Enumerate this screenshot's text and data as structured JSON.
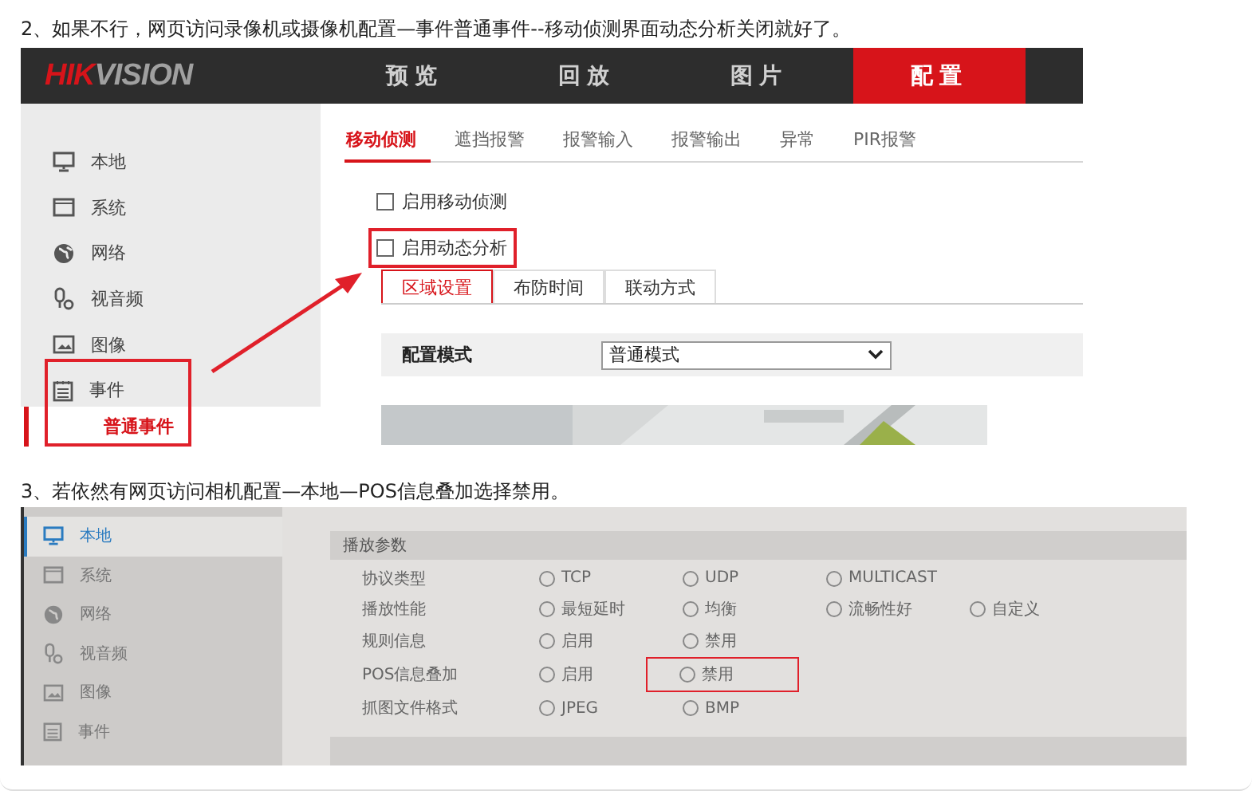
{
  "step_2": {
    "text": "2、如果不行，网页访问录像机或摄像机配置—事件普通事件--移动侦测界面动态分析关闭就好了。",
    "screenshot": {
      "logo": [
        {
          "text": "HIK",
          "color": "#d7141a"
        },
        {
          "text": "VISION",
          "color": "#a0a0a0"
        }
      ],
      "nav": [
        {
          "label": "预览",
          "selected": false
        },
        {
          "label": "回放",
          "selected": false
        },
        {
          "label": "图片",
          "selected": false
        },
        {
          "label": "配置",
          "selected": true
        }
      ],
      "sidebar": [
        {
          "label": "本地",
          "annotated": false
        },
        {
          "label": "系统",
          "annotated": false
        },
        {
          "label": "网络",
          "annotated": false
        },
        {
          "label": "视音频",
          "annotated": false
        },
        {
          "label": "图像",
          "annotated": false
        },
        {
          "label": "事件",
          "annotated": true,
          "children": [
            {
              "label": "普通事件",
              "selected": true
            }
          ]
        }
      ],
      "tabs": [
        {
          "label": "移动侦测",
          "selected": true
        },
        {
          "label": "遮挡报警",
          "selected": false
        },
        {
          "label": "报警输入",
          "selected": false
        },
        {
          "label": "报警输出",
          "selected": false
        },
        {
          "label": "异常",
          "selected": false
        },
        {
          "label": "PIR报警",
          "selected": false
        }
      ],
      "checkboxes": [
        {
          "label": "启用移动侦测",
          "checked": false,
          "annotated": false
        },
        {
          "label": "启用动态分析",
          "checked": false,
          "annotated": true
        }
      ],
      "subtabs": [
        {
          "label": "区域设置",
          "selected": true
        },
        {
          "label": "布防时间",
          "selected": false
        },
        {
          "label": "联动方式",
          "selected": false
        }
      ],
      "config": {
        "label": "配置模式",
        "value": "普通模式"
      }
    }
  },
  "step_3": {
    "text": "3、若依然有网页访问相机配置—本地—POS信息叠加选择禁用。",
    "screenshot": {
      "sidebar": [
        {
          "label": "本地",
          "selected": true
        },
        {
          "label": "系统",
          "selected": false
        },
        {
          "label": "网络",
          "selected": false
        },
        {
          "label": "视音频",
          "selected": false
        },
        {
          "label": "图像",
          "selected": false
        },
        {
          "label": "事件",
          "selected": false
        }
      ],
      "section": "播放参数",
      "rows": [
        {
          "label": "协议类型",
          "options": [
            {
              "label": "TCP",
              "annotated": false
            },
            {
              "label": "UDP",
              "annotated": false
            },
            {
              "label": "MULTICAST",
              "annotated": false
            }
          ]
        },
        {
          "label": "播放性能",
          "options": [
            {
              "label": "最短延时",
              "annotated": false
            },
            {
              "label": "均衡",
              "annotated": false
            },
            {
              "label": "流畅性好",
              "annotated": false
            },
            {
              "label": "自定义",
              "annotated": false
            }
          ]
        },
        {
          "label": "规则信息",
          "options": [
            {
              "label": "启用",
              "annotated": false
            },
            {
              "label": "禁用",
              "annotated": false
            }
          ]
        },
        {
          "label": "POS信息叠加",
          "options": [
            {
              "label": "启用",
              "annotated": false
            },
            {
              "label": "禁用",
              "annotated": true
            }
          ]
        },
        {
          "label": "抓图文件格式",
          "options": [
            {
              "label": "JPEG",
              "annotated": false
            },
            {
              "label": "BMP",
              "annotated": false
            }
          ]
        }
      ]
    }
  }
}
